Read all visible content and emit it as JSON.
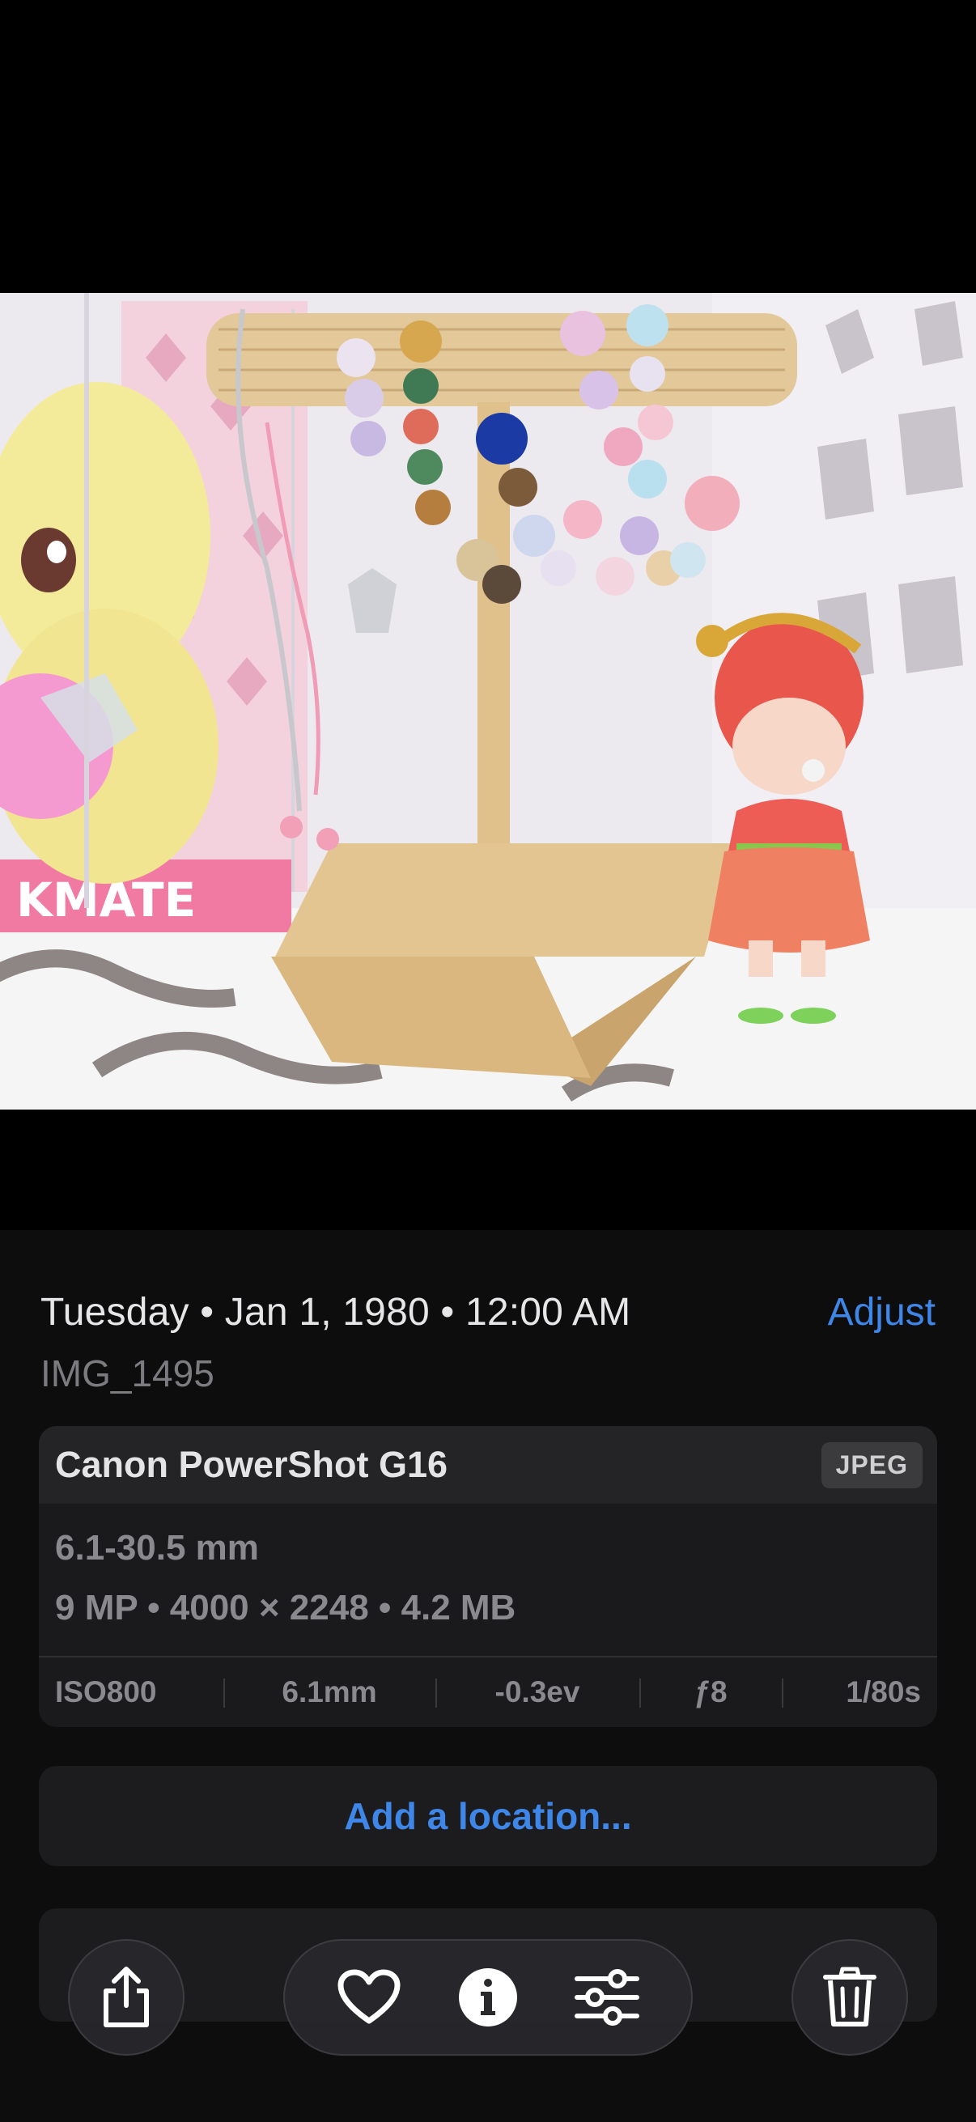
{
  "photo": {
    "box_text": "KMATE"
  },
  "info": {
    "date": "Tuesday • Jan 1, 1980 • 12:00 AM",
    "adjust_label": "Adjust",
    "filename": "IMG_1495"
  },
  "exif": {
    "camera": "Canon PowerShot G16",
    "format": "JPEG",
    "lens": "6.1-30.5 mm",
    "specs": "9 MP • 4000 × 2248 • 4.2 MB",
    "iso": "ISO800",
    "focal": "6.1mm",
    "exposure": "-0.3ev",
    "aperture": "ƒ8",
    "shutter": "1/80s"
  },
  "location": {
    "label": "Add a location..."
  },
  "toolbar": {
    "share_icon": "share-icon",
    "favorite_icon": "heart-icon",
    "info_icon": "info-icon",
    "adjust_icon": "sliders-icon",
    "delete_icon": "trash-icon"
  },
  "colors": {
    "accent": "#3e86e8",
    "panel_bg": "#0d0d0e",
    "card_bg": "#1a1a1c"
  }
}
